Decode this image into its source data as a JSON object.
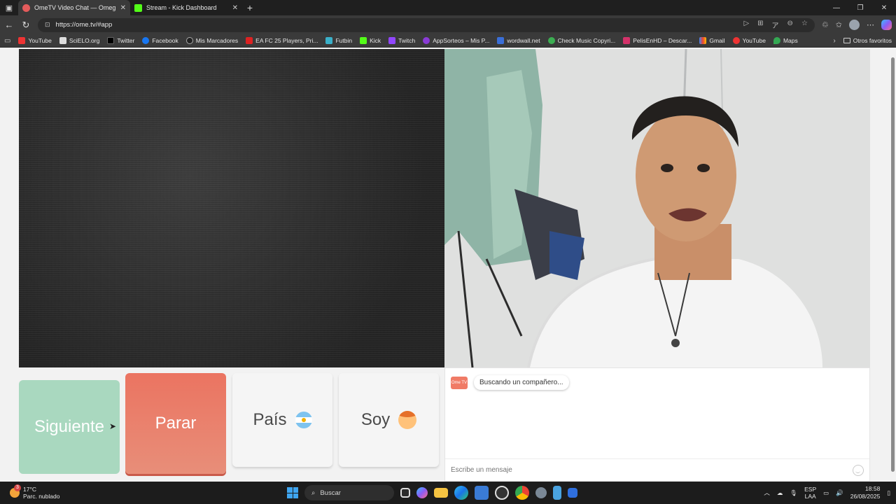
{
  "browser": {
    "tabs": [
      {
        "title": "OmeTV Video Chat — Omegle",
        "active": true
      },
      {
        "title": "Stream - Kick Dashboard",
        "active": false
      }
    ],
    "url": "https://ome.tv/#app",
    "bookmarks": [
      "YouTube",
      "SciELO.org",
      "Twitter",
      "Facebook",
      "Mis Marcadores",
      "EA FC 25 Players, Pri...",
      "Futbin",
      "Kick",
      "Twitch",
      "AppSorteos – Mis P...",
      "wordwall.net",
      "Check Music Copyri...",
      "PelisEnHD – Descar...",
      "Gmail",
      "YouTube",
      "Maps"
    ],
    "other_favorites": "Otros favoritos"
  },
  "controls": {
    "next": "Siguiente",
    "stop": "Parar",
    "country": "País",
    "gender": "Soy"
  },
  "chat": {
    "logo": "Ome TV",
    "status_message": "Buscando un compañero...",
    "input_placeholder": "Escribe un mensaje"
  },
  "taskbar": {
    "weather_temp": "17°C",
    "weather_desc": "Parc. nublado",
    "weather_badge": "3",
    "search": "Buscar",
    "lang_top": "ESP",
    "lang_bottom": "LAA",
    "time": "18:58",
    "date": "26/08/2025"
  },
  "colors": {
    "next": "#a9d8bf",
    "stop": "#eb7461",
    "brand": "#f07b66"
  }
}
